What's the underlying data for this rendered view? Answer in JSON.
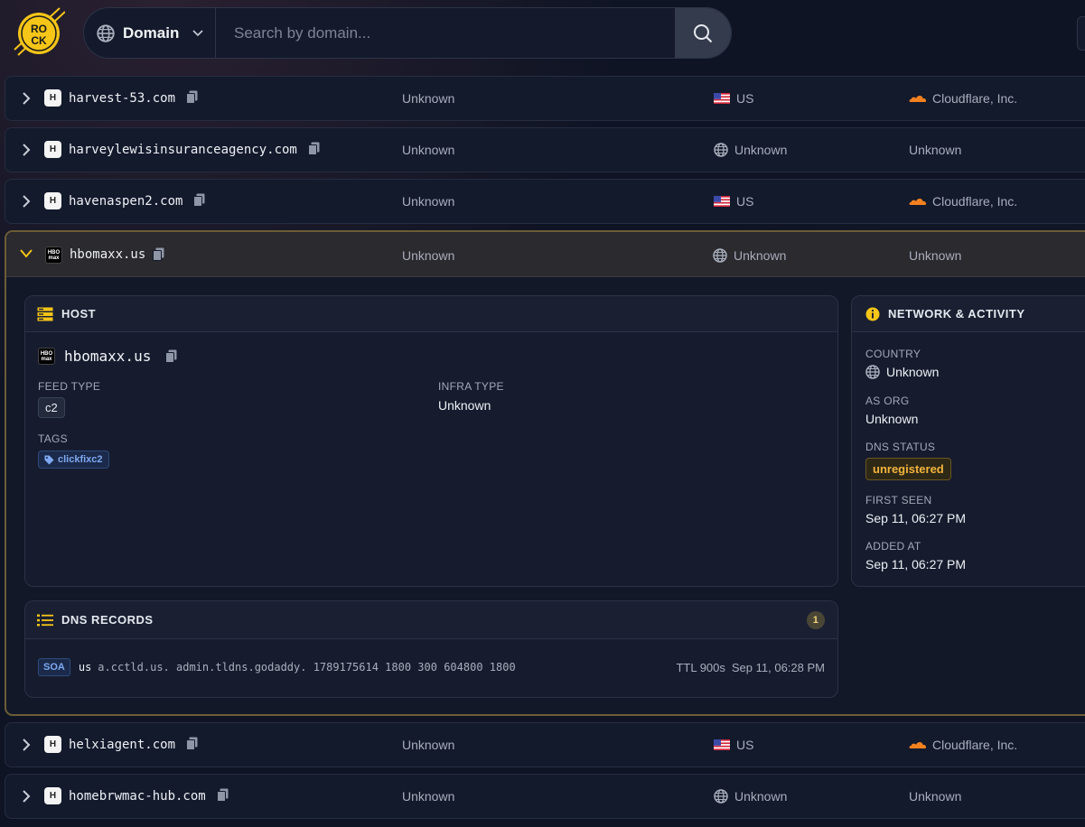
{
  "logo": {
    "text_top": "RO",
    "text_bottom": "CK"
  },
  "search": {
    "type_label": "Domain",
    "placeholder": "Search by domain...",
    "type_icon": "globe-icon",
    "button_icon": "search-icon"
  },
  "rows_before": [
    {
      "favicon": "H",
      "domain": "harvest-53.com",
      "infra": "Unknown",
      "country": "US",
      "country_icon": "us-flag-icon",
      "asorg": "Cloudflare, Inc.",
      "asorg_icon": "cloudflare-icon"
    },
    {
      "favicon": "H",
      "domain": "harveylewisinsuranceagency.com",
      "infra": "Unknown",
      "country": "Unknown",
      "country_icon": "globe-icon",
      "asorg": "Unknown",
      "asorg_icon": ""
    },
    {
      "favicon": "H",
      "domain": "havenaspen2.com",
      "infra": "Unknown",
      "country": "US",
      "country_icon": "us-flag-icon",
      "asorg": "Cloudflare, Inc.",
      "asorg_icon": "cloudflare-icon"
    }
  ],
  "expanded": {
    "favicon_lines": [
      "HBO",
      "max"
    ],
    "domain": "hbomaxx.us",
    "infra": "Unknown",
    "country": "Unknown",
    "asorg": "Unknown",
    "host_card": {
      "title": "HOST",
      "domain": "hbomaxx.us",
      "feed_type_label": "FEED TYPE",
      "feed_type": "c2",
      "infra_type_label": "INFRA TYPE",
      "infra_type": "Unknown",
      "tags_label": "TAGS",
      "tags": [
        "clickfixc2"
      ]
    },
    "network_card": {
      "title": "NETWORK & ACTIVITY",
      "country_label": "COUNTRY",
      "country": "Unknown",
      "as_org_label": "AS ORG",
      "as_org": "Unknown",
      "dns_status_label": "DNS STATUS",
      "dns_status": "unregistered",
      "first_seen_label": "FIRST SEEN",
      "first_seen": "Sep 11, 06:27 PM",
      "added_at_label": "ADDED AT",
      "added_at": "Sep 11, 06:27 PM"
    },
    "dns_card": {
      "title": "DNS RECORDS",
      "count": "1",
      "records": [
        {
          "type": "SOA",
          "name": "us",
          "value": "a.cctld.us. admin.tldns.godaddy. 1789175614 1800 300 604800 1800",
          "ttl": "TTL 900s",
          "time": "Sep 11, 06:28 PM"
        }
      ]
    }
  },
  "rows_after": [
    {
      "favicon": "H",
      "domain": "helxiagent.com",
      "infra": "Unknown",
      "country": "US",
      "country_icon": "us-flag-icon",
      "asorg": "Cloudflare, Inc.",
      "asorg_icon": "cloudflare-icon"
    },
    {
      "favicon": "H",
      "domain": "homebrwmac-hub.com",
      "infra": "Unknown",
      "country": "Unknown",
      "country_icon": "globe-icon",
      "asorg": "Unknown",
      "asorg_icon": ""
    }
  ],
  "colors": {
    "accent": "#f5c518",
    "expanded_border": "#6c5d37",
    "tag_blue": "#7fa9f2",
    "warning": "#f2b43c"
  }
}
